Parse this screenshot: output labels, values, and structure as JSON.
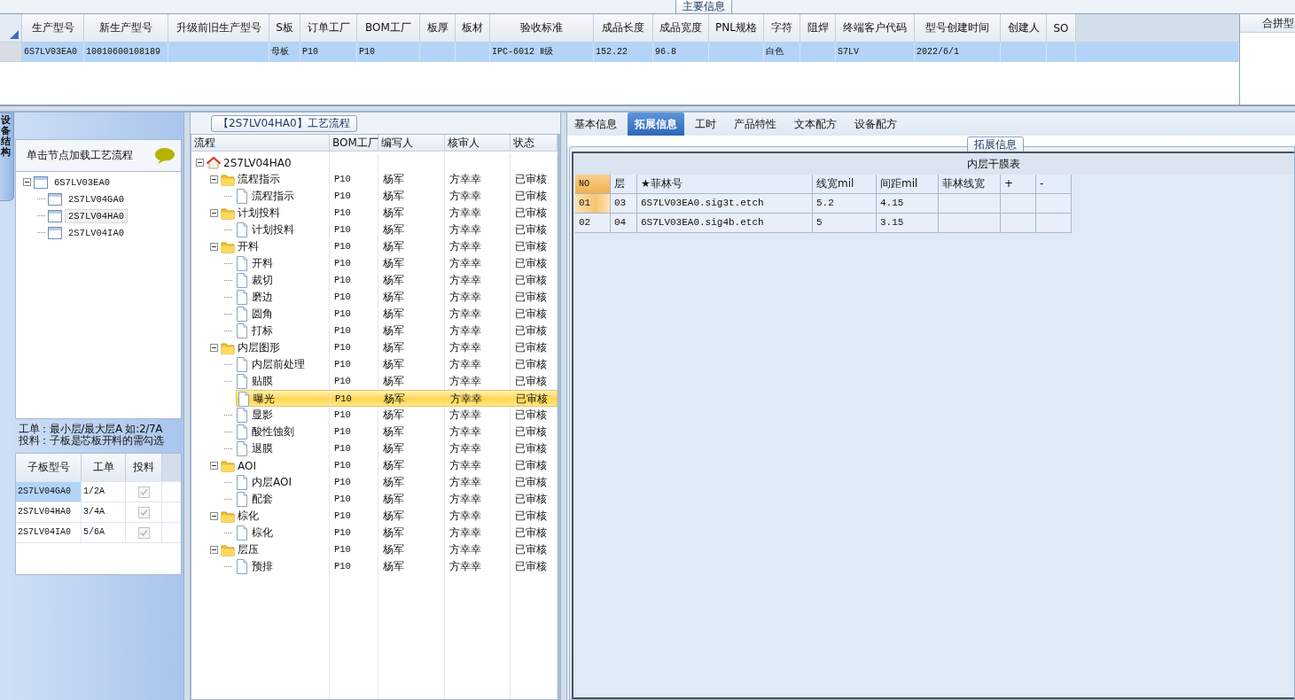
{
  "main_info": {
    "group_title": "主要信息",
    "columns": [
      "生产型号",
      "新生产型号",
      "升级前旧生产型号",
      "S板",
      "订单工厂",
      "BOM工厂",
      "板厚",
      "板材",
      "验收标准",
      "成品长度",
      "成品宽度",
      "PNL规格",
      "字符",
      "阻焊",
      "终端客户代码",
      "型号创建时间",
      "创建人",
      "SO"
    ],
    "rows": [
      {
        "selected": true,
        "cells": [
          "6S7LV03EA0",
          "10010600108189",
          null,
          "母板",
          "P10",
          "P10",
          null,
          null,
          "IPC-6012 Ⅱ级",
          "152.22",
          "96.8",
          null,
          "白色",
          null,
          "S7LV",
          "2022/6/1",
          null,
          null
        ]
      }
    ]
  },
  "merge_panel": {
    "title": "合拼型"
  },
  "side_tab": {
    "label": "设备结构"
  },
  "structure": {
    "hint": "单击节点加载工艺流程",
    "tree": [
      {
        "label": "6S7LV03EA0",
        "expanded": true,
        "selected": false,
        "children": [
          {
            "label": "2S7LV04GA0",
            "selected": false
          },
          {
            "label": "2S7LV04HA0",
            "selected": true
          },
          {
            "label": "2S7LV04IA0",
            "selected": false
          }
        ]
      }
    ],
    "notes": [
      "工单：最小层/最大层A 如:2/7A",
      "投料：子板是芯板开料的需勾选"
    ],
    "columns": [
      "子板型号",
      "工单",
      "投料"
    ],
    "rows": [
      {
        "cells": [
          "2S7LV04GA0",
          "1/2A"
        ],
        "checked": true,
        "selected": true
      },
      {
        "cells": [
          "2S7LV04HA0",
          "3/4A"
        ],
        "checked": true,
        "selected": false
      },
      {
        "cells": [
          "2S7LV04IA0",
          "5/6A"
        ],
        "checked": true,
        "selected": false
      }
    ]
  },
  "process": {
    "group_title": "【2S7LV04HA0】工艺流程",
    "columns": [
      "流程",
      "BOM工厂",
      "编写人",
      "核审人",
      "状态"
    ],
    "tree": [
      {
        "kind": "root",
        "label": "2S7LV04HA0",
        "expanded": true,
        "selected": false,
        "children": [
          {
            "kind": "folder",
            "label": "流程指示",
            "expanded": true,
            "selected": false,
            "values": [
              "P10",
              "杨军",
              "方幸幸",
              "已审核"
            ],
            "children": [
              {
                "kind": "step",
                "label": "流程指示",
                "selected": false,
                "values": [
                  "P10",
                  "杨军",
                  "方幸幸",
                  "已审核"
                ]
              }
            ]
          },
          {
            "kind": "folder",
            "label": "计划投料",
            "expanded": true,
            "selected": false,
            "values": [
              "P10",
              "杨军",
              "方幸幸",
              "已审核"
            ],
            "children": [
              {
                "kind": "step",
                "label": "计划投料",
                "selected": false,
                "values": [
                  "P10",
                  "杨军",
                  "方幸幸",
                  "已审核"
                ]
              }
            ]
          },
          {
            "kind": "folder",
            "label": "开料",
            "expanded": true,
            "selected": false,
            "values": [
              "P10",
              "杨军",
              "方幸幸",
              "已审核"
            ],
            "children": [
              {
                "kind": "step",
                "label": "开料",
                "selected": false,
                "values": [
                  "P10",
                  "杨军",
                  "方幸幸",
                  "已审核"
                ]
              },
              {
                "kind": "step",
                "label": "裁切",
                "selected": false,
                "values": [
                  "P10",
                  "杨军",
                  "方幸幸",
                  "已审核"
                ]
              },
              {
                "kind": "step",
                "label": "磨边",
                "selected": false,
                "values": [
                  "P10",
                  "杨军",
                  "方幸幸",
                  "已审核"
                ]
              },
              {
                "kind": "step",
                "label": "圆角",
                "selected": false,
                "values": [
                  "P10",
                  "杨军",
                  "方幸幸",
                  "已审核"
                ]
              },
              {
                "kind": "step",
                "label": "打标",
                "selected": false,
                "values": [
                  "P10",
                  "杨军",
                  "方幸幸",
                  "已审核"
                ]
              }
            ]
          },
          {
            "kind": "folder",
            "label": "内层图形",
            "expanded": true,
            "selected": false,
            "values": [
              "P10",
              "杨军",
              "方幸幸",
              "已审核"
            ],
            "children": [
              {
                "kind": "step",
                "label": "内层前处理",
                "selected": false,
                "values": [
                  "P10",
                  "杨军",
                  "方幸幸",
                  "已审核"
                ]
              },
              {
                "kind": "step",
                "label": "贴膜",
                "selected": false,
                "values": [
                  "P10",
                  "杨军",
                  "方幸幸",
                  "已审核"
                ]
              },
              {
                "kind": "step",
                "label": "曝光",
                "selected": true,
                "values": [
                  "P10",
                  "杨军",
                  "方幸幸",
                  "已审核"
                ]
              },
              {
                "kind": "step",
                "label": "显影",
                "selected": false,
                "values": [
                  "P10",
                  "杨军",
                  "方幸幸",
                  "已审核"
                ]
              },
              {
                "kind": "step",
                "label": "酸性蚀刻",
                "selected": false,
                "values": [
                  "P10",
                  "杨军",
                  "方幸幸",
                  "已审核"
                ]
              },
              {
                "kind": "step",
                "label": "退膜",
                "selected": false,
                "values": [
                  "P10",
                  "杨军",
                  "方幸幸",
                  "已审核"
                ]
              }
            ]
          },
          {
            "kind": "folder",
            "label": "AOI",
            "expanded": true,
            "selected": false,
            "values": [
              "P10",
              "杨军",
              "方幸幸",
              "已审核"
            ],
            "children": [
              {
                "kind": "step",
                "label": "内层AOI",
                "selected": false,
                "values": [
                  "P10",
                  "杨军",
                  "方幸幸",
                  "已审核"
                ]
              },
              {
                "kind": "step",
                "label": "配套",
                "selected": false,
                "values": [
                  "P10",
                  "杨军",
                  "方幸幸",
                  "已审核"
                ]
              }
            ]
          },
          {
            "kind": "folder",
            "label": "棕化",
            "expanded": true,
            "selected": false,
            "values": [
              "P10",
              "杨军",
              "方幸幸",
              "已审核"
            ],
            "children": [
              {
                "kind": "step",
                "label": "棕化",
                "selected": false,
                "values": [
                  "P10",
                  "杨军",
                  "方幸幸",
                  "已审核"
                ]
              }
            ]
          },
          {
            "kind": "folder",
            "label": "层压",
            "expanded": true,
            "selected": false,
            "values": [
              "P10",
              "杨军",
              "方幸幸",
              "已审核"
            ],
            "children": [
              {
                "kind": "step",
                "label": "预排",
                "selected": false,
                "values": [
                  "P10",
                  "杨军",
                  "方幸幸",
                  "已审核"
                ]
              }
            ]
          }
        ]
      }
    ]
  },
  "detail": {
    "tabs": [
      {
        "label": "基本信息",
        "selected": false
      },
      {
        "label": "拓展信息",
        "selected": true
      },
      {
        "label": "工时",
        "selected": false
      },
      {
        "label": "产品特性",
        "selected": false
      },
      {
        "label": "文本配方",
        "selected": false
      },
      {
        "label": "设备配方",
        "selected": false
      }
    ],
    "group_title": "拓展信息",
    "table": {
      "title": "内层干膜表",
      "columns": [
        "NO",
        "层",
        "★菲林号",
        "线宽mil",
        "间距mil",
        "菲林线宽",
        "+",
        "-"
      ],
      "rows": [
        {
          "selected": true,
          "cells": [
            "01",
            "03",
            "6S7LV03EA0.sig3t.etch",
            "5.2",
            "4.15"
          ]
        },
        {
          "selected": false,
          "cells": [
            "02",
            "04",
            "6S7LV03EA0.sig4b.etch",
            "5",
            "3.15"
          ]
        }
      ]
    }
  }
}
